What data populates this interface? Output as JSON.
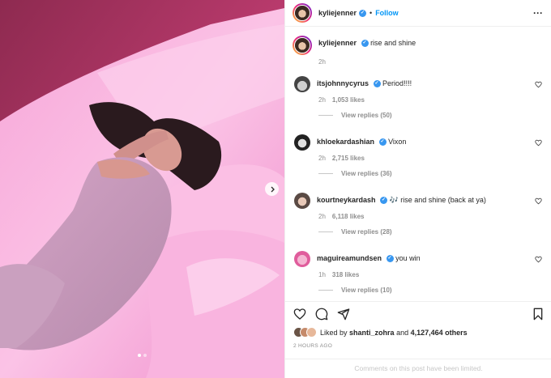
{
  "header": {
    "username": "kyliejenner",
    "separator": "•",
    "follow_label": "Follow",
    "more_icon": "more-horizontal-icon"
  },
  "caption": {
    "username": "kyliejenner",
    "text": "rise and shine",
    "time": "2h"
  },
  "comments": [
    {
      "username": "itsjohnnycyrus",
      "text": "Period!!!!",
      "time": "2h",
      "likes": "1,053 likes",
      "replies": "View replies (50)"
    },
    {
      "username": "khloekardashian",
      "text": "Vixon",
      "time": "2h",
      "likes": "2,715 likes",
      "replies": "View replies (36)"
    },
    {
      "username": "kourtneykardash",
      "text": "🎶 rise and shine (back at ya)",
      "time": "2h",
      "likes": "6,118 likes",
      "replies": "View replies (28)"
    },
    {
      "username": "maguireamundsen",
      "text": "you win",
      "time": "1h",
      "likes": "318 likes",
      "replies": "View replies (10)"
    }
  ],
  "likes": {
    "prefix": "Liked by",
    "user": "shanti_zohra",
    "conjunction": "and",
    "others": "4,127,464 others"
  },
  "timestamp": "2 HOURS AGO",
  "comments_limited": "Comments on this post have been limited.",
  "carousel": {
    "slides": 2,
    "active_index": 0
  },
  "colors": {
    "accent": "#0095f6",
    "verified": "#3897f0",
    "muted": "#8e8e8e"
  }
}
